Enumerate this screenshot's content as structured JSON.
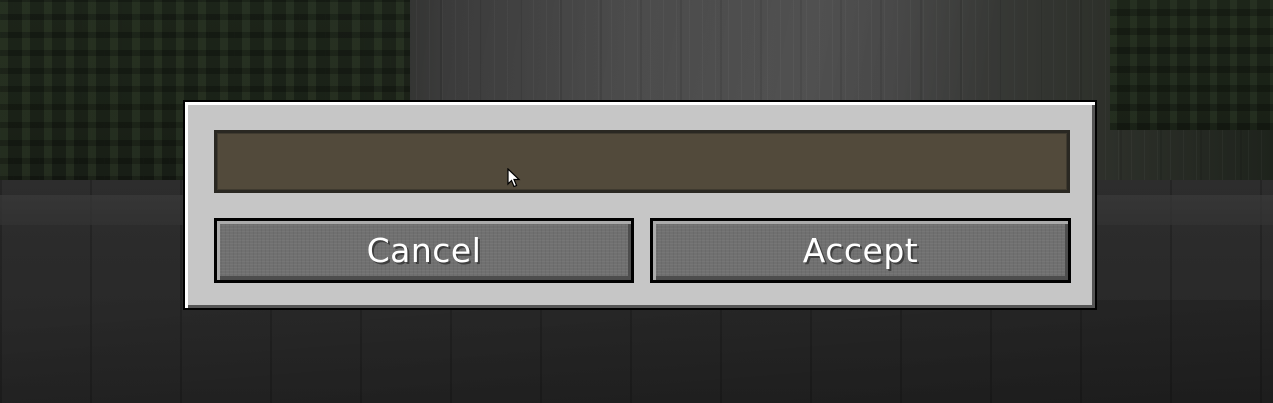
{
  "dialog": {
    "text_field": {
      "value": "",
      "placeholder": ""
    },
    "cancel_label": "Cancel",
    "accept_label": "Accept"
  },
  "colors": {
    "panel": "#c6c6c6",
    "field_bg": "#524a3b",
    "button_bg": "#707070",
    "button_text": "#ffffff"
  },
  "icons": {
    "cursor": "mouse-pointer-icon"
  }
}
